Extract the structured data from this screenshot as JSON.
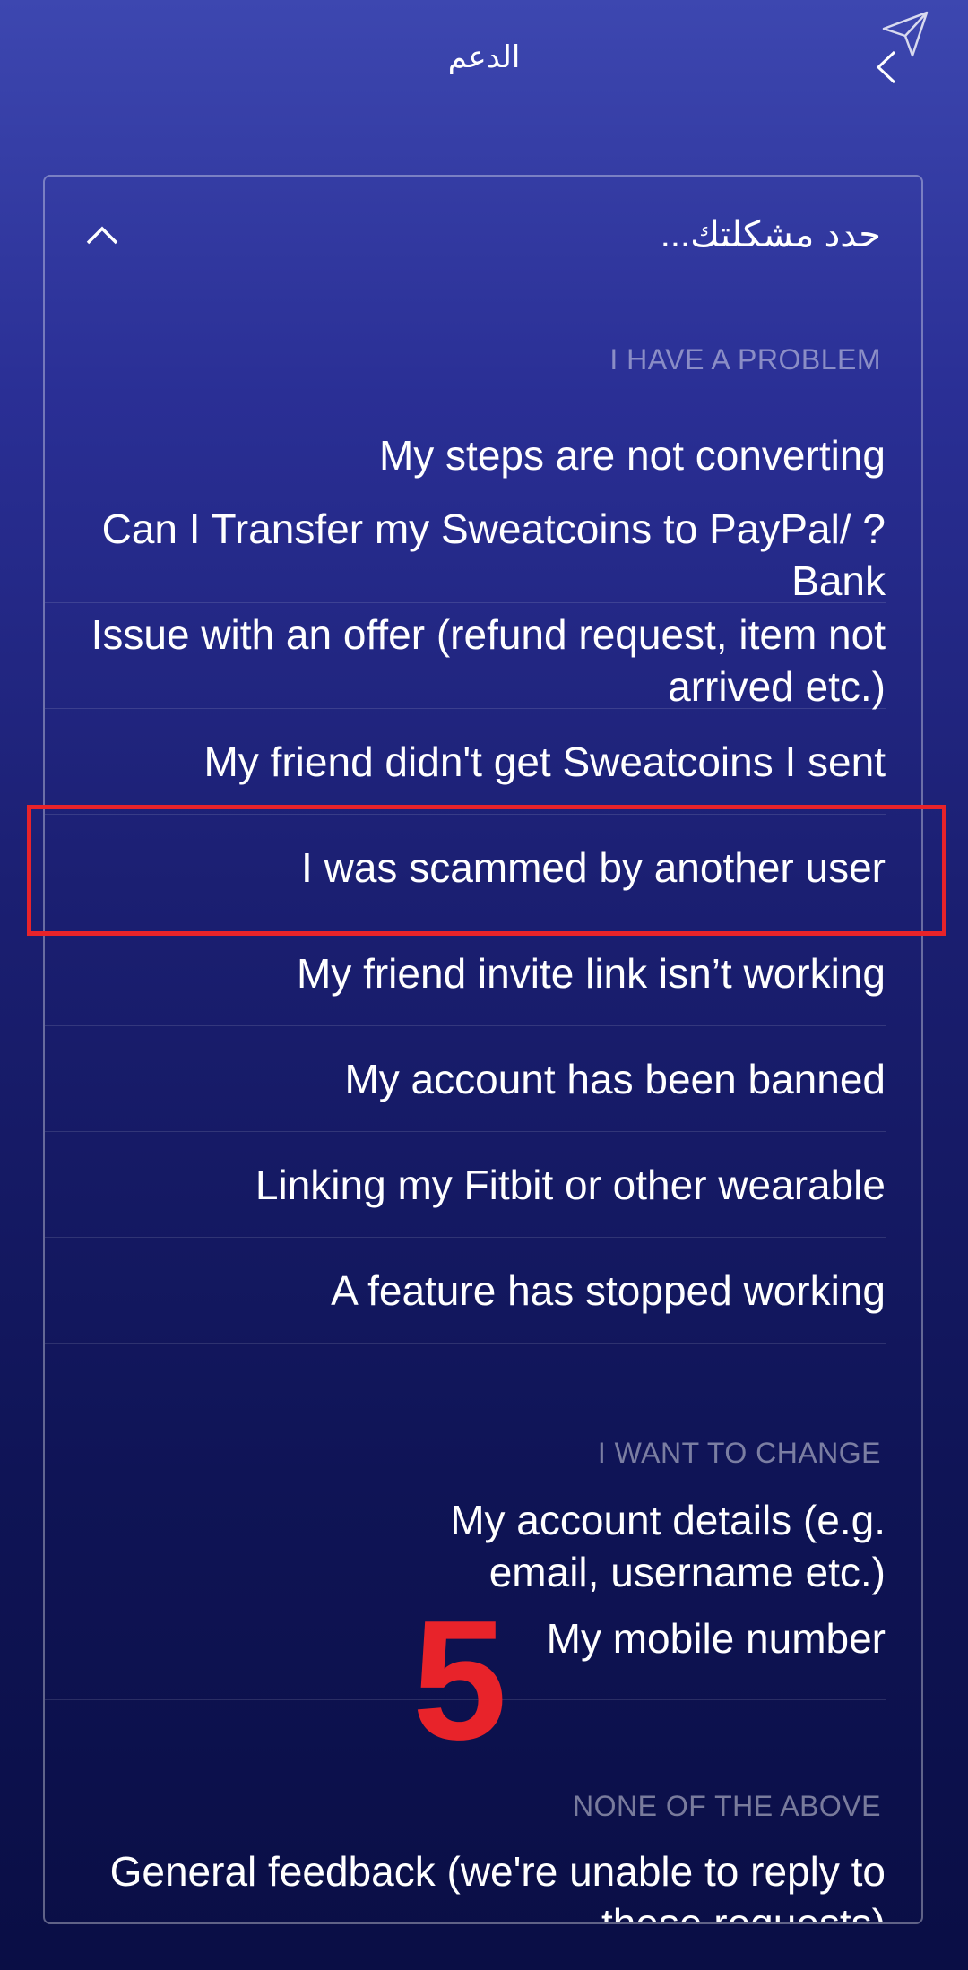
{
  "header": {
    "title": "الدعم"
  },
  "selector": {
    "placeholder": "حدد مشكلتك..."
  },
  "sections": {
    "problem_label": "I HAVE A PROBLEM",
    "change_label": "I WANT TO CHANGE",
    "none_label": "NONE OF THE ABOVE"
  },
  "problem_items": [
    "My steps are not converting",
    "Can I Transfer my Sweatcoins to PayPal/ ?Bank",
    "Issue with an offer (refund request, item not arrived etc.)",
    "My friend didn't get Sweatcoins I sent",
    "I was scammed by another user",
    "My friend invite link isn’t working",
    "My account has been banned",
    "Linking my Fitbit or other wearable",
    "A feature has stopped working"
  ],
  "change_items": [
    "My account details (e.g. email, username etc.)",
    "My mobile number"
  ],
  "none_items": [
    "General feedback (we're unable to reply to these requests)"
  ],
  "annotation": {
    "step_number": "5"
  },
  "colors": {
    "highlight": "#e8232a",
    "background_top": "#3d47b0",
    "background_bottom": "#0a0e45"
  }
}
